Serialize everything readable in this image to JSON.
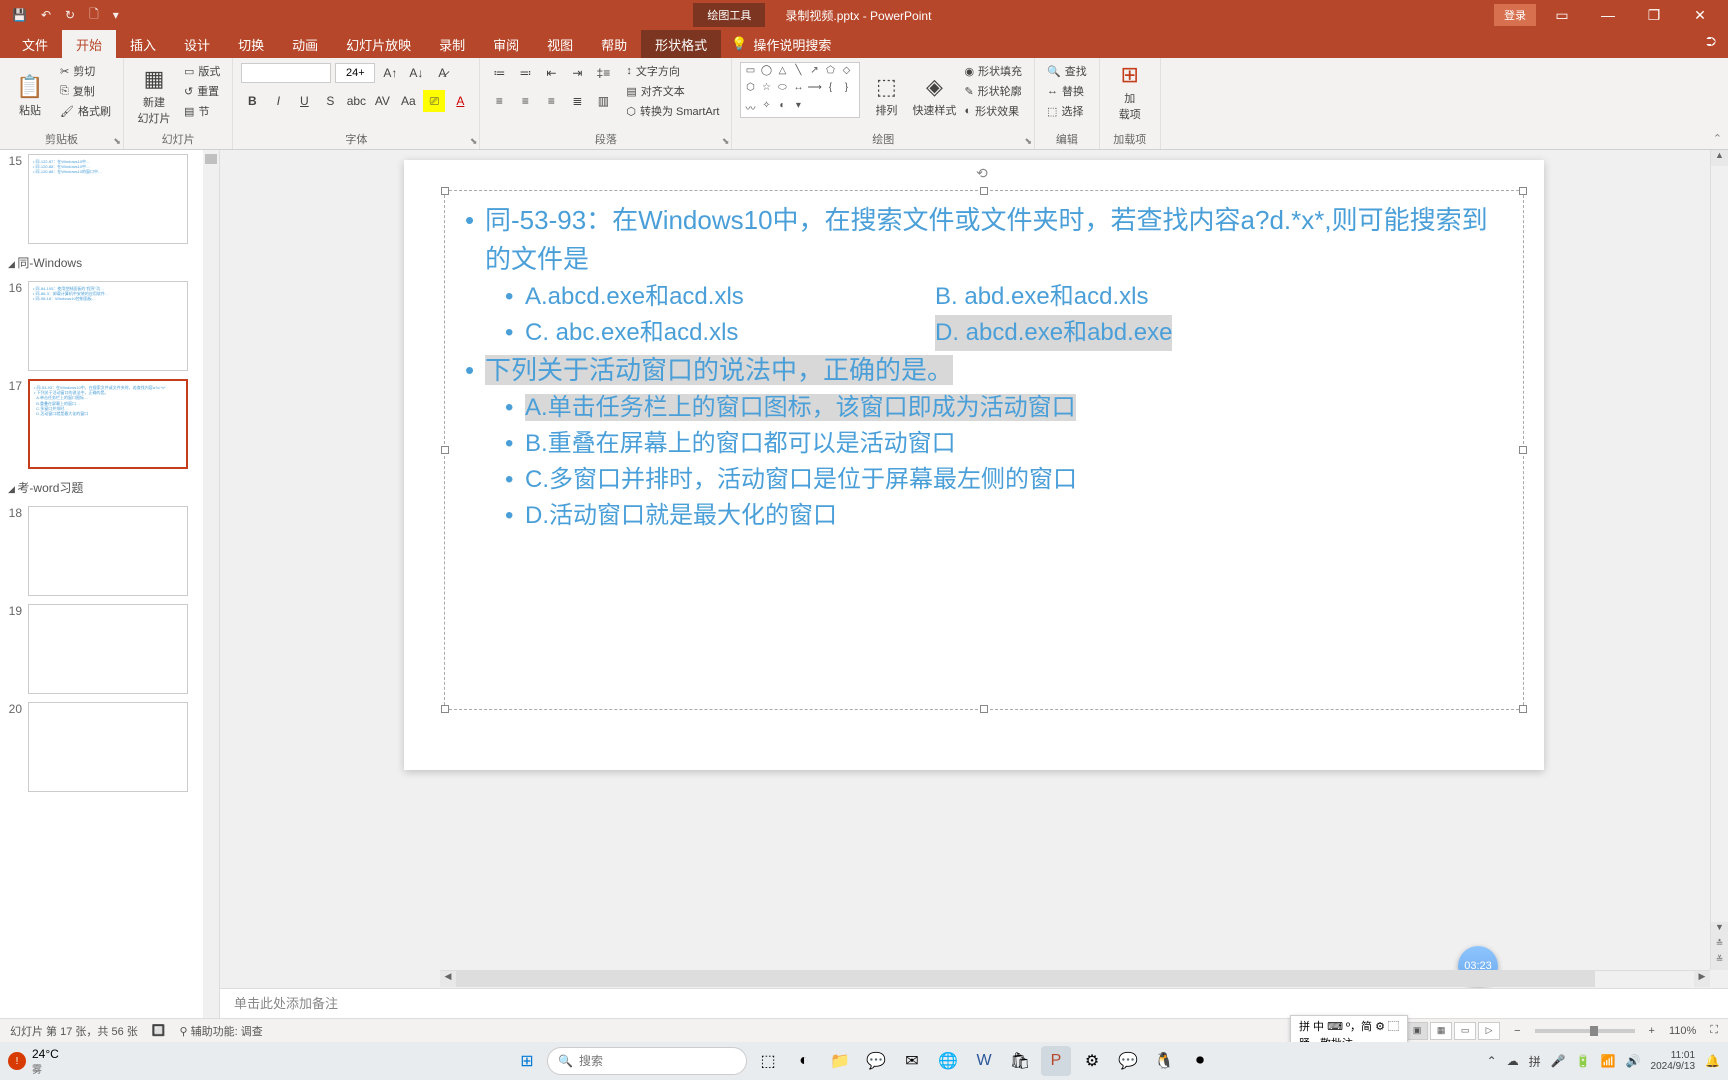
{
  "title_bar": {
    "context_tab": "绘图工具",
    "doc_title": "录制视频.pptx - PowerPoint",
    "login": "登录"
  },
  "ribbon_tabs": [
    "文件",
    "开始",
    "插入",
    "设计",
    "切换",
    "动画",
    "幻灯片放映",
    "录制",
    "审阅",
    "视图",
    "帮助",
    "形状格式"
  ],
  "tell_me": "操作说明搜索",
  "ribbon": {
    "clipboard": {
      "label": "剪贴板",
      "paste": "粘贴",
      "cut": "剪切",
      "copy": "复制",
      "format_painter": "格式刷"
    },
    "slides": {
      "label": "幻灯片",
      "new_slide": "新建\n幻灯片",
      "layout": "版式",
      "reset": "重置",
      "section": "节"
    },
    "font": {
      "label": "字体",
      "size": "24+"
    },
    "paragraph": {
      "label": "段落",
      "text_dir": "文字方向",
      "align_text": "对齐文本",
      "smartart": "转换为 SmartArt"
    },
    "drawing": {
      "label": "绘图",
      "arrange": "排列",
      "quick": "快速样式",
      "fill": "形状填充",
      "outline": "形状轮廓",
      "effects": "形状效果"
    },
    "editing": {
      "label": "编辑",
      "find": "查找",
      "replace": "替换",
      "select": "选择"
    },
    "addins": {
      "label": "加载项",
      "btn": "加\n载项"
    }
  },
  "sections": {
    "s1": "同-Windows",
    "s2": "考-word习题"
  },
  "thumbs": [
    {
      "num": "15"
    },
    {
      "num": "16"
    },
    {
      "num": "17",
      "active": true
    },
    {
      "num": "18"
    },
    {
      "num": "19"
    },
    {
      "num": "20"
    }
  ],
  "slide": {
    "q1": "同-53-93：在Windows10中，在搜索文件或文件夹时，若查找内容a?d.*x*,则可能搜索到的文件是",
    "q1a": "A.abcd.exe和acd.xls",
    "q1b": "B. abd.exe和acd.xls",
    "q1c": "C. abc.exe和acd.xls",
    "q1d": "D. abcd.exe和abd.exe",
    "q2": "下列关于活动窗口的说法中，正确的是。",
    "q2a": "A.单击任务栏上的窗口图标，该窗口即成为活动窗口",
    "q2b": "B.重叠在屏幕上的窗口都可以是活动窗口",
    "q2c": "C.多窗口并排时，活动窗口是位于屏幕最左侧的窗口",
    "q2d": "D.活动窗口就是最大化的窗口"
  },
  "notes_placeholder": "单击此处添加备注",
  "status": {
    "slide_info": "幻灯片 第 17 张，共 56 张",
    "a11y": "辅助功能: 调查",
    "zoom": "110%"
  },
  "ime": {
    "row1": "拼 中 ⌨ º，简 ⚙ ⬚",
    "row2_a": "踊",
    "row2_b": "敬批注"
  },
  "clock_badge": "03:23",
  "taskbar": {
    "temp": "24°C",
    "weather": "雾",
    "search": "搜索",
    "time": "11:01",
    "date": "2024/9/13"
  }
}
